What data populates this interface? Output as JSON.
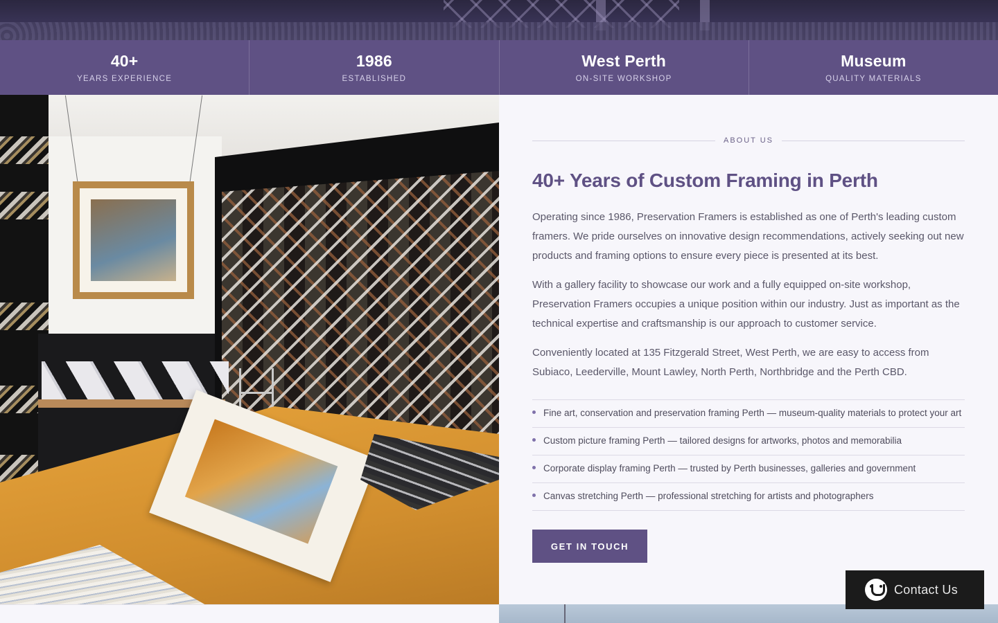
{
  "stats": [
    {
      "value": "40+",
      "label": "YEARS EXPERIENCE"
    },
    {
      "value": "1986",
      "label": "ESTABLISHED"
    },
    {
      "value": "West Perth",
      "label": "ON-SITE WORKSHOP"
    },
    {
      "value": "Museum",
      "label": "QUALITY MATERIALS"
    }
  ],
  "about": {
    "eyebrow": "ABOUT US",
    "title": "40+ Years of Custom Framing in Perth",
    "paragraphs": [
      "Operating since 1986, Preservation Framers is established as one of Perth's leading custom framers. We pride ourselves on innovative design recommendations, actively seeking out new products and framing options to ensure every piece is presented at its best.",
      "With a gallery facility to showcase our work and a fully equipped on-site workshop, Preservation Framers occupies a unique position within our industry. Just as important as the technical expertise and craftsmanship is our approach to customer service.",
      "Conveniently located at 135 Fitzgerald Street, West Perth, we are easy to access from Subiaco, Leederville, Mount Lawley, North Perth, Northbridge and the Perth CBD."
    ],
    "services": [
      "Fine art, conservation and preservation framing Perth — museum-quality materials to protect your art",
      "Custom picture framing Perth — tailored designs for artworks, photos and memorabilia",
      "Corporate display framing Perth — trusted by Perth businesses, galleries and government",
      "Canvas stretching Perth — professional stretching for artists and photographers"
    ],
    "cta_label": "GET IN TOUCH"
  },
  "chat": {
    "label": "Contact Us",
    "icon": "chat-icon"
  },
  "colors": {
    "brand": "#5f5184",
    "background": "#f7f6fb",
    "chat_bg": "#1b1b1b"
  }
}
